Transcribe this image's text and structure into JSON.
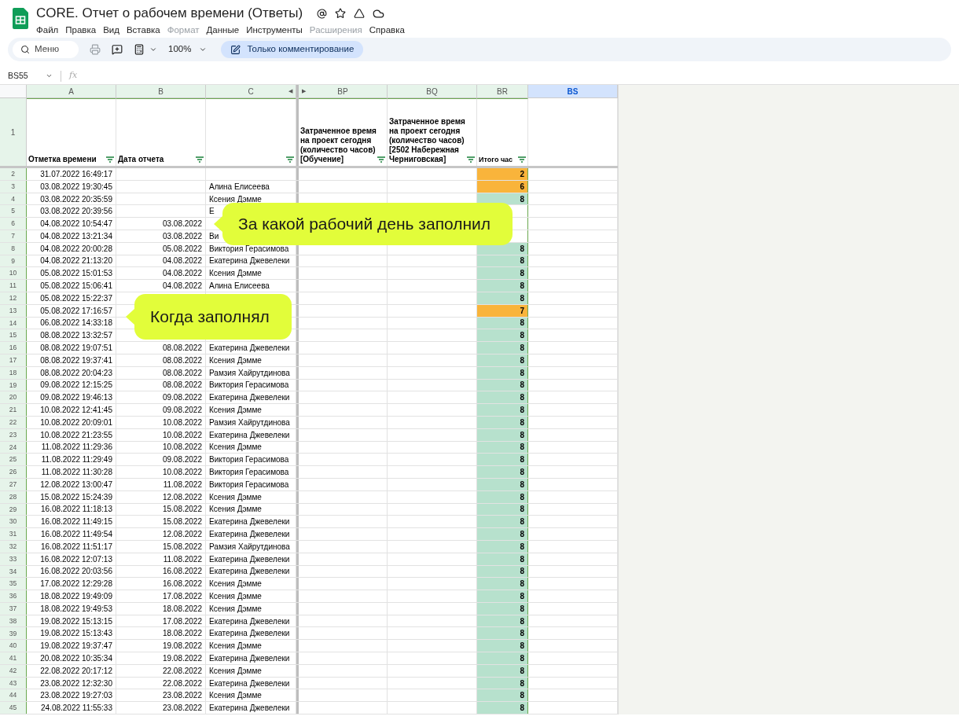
{
  "doc": {
    "title": "CORE. Отчет о рабочем времени (Ответы)"
  },
  "menu": [
    {
      "label": "Файл",
      "disabled": false
    },
    {
      "label": "Правка",
      "disabled": false
    },
    {
      "label": "Вид",
      "disabled": false
    },
    {
      "label": "Вставка",
      "disabled": false
    },
    {
      "label": "Формат",
      "disabled": true
    },
    {
      "label": "Данные",
      "disabled": false
    },
    {
      "label": "Инструменты",
      "disabled": false
    },
    {
      "label": "Расширения",
      "disabled": true
    },
    {
      "label": "Справка",
      "disabled": false
    }
  ],
  "toolbar": {
    "search_placeholder": "Меню",
    "zoom": "100%",
    "mode_button": "Только комментирование"
  },
  "formula_bar": {
    "name_box": "BS55",
    "fx": "fx"
  },
  "header_row": "1",
  "columns": [
    {
      "letter": "A",
      "selected": false,
      "header": "Отметка времени",
      "filter": true
    },
    {
      "letter": "B",
      "selected": false,
      "header": "Дата отчета",
      "filter": true
    },
    {
      "letter": "C",
      "selected": false,
      "filter": true,
      "arrow": "◀"
    },
    {
      "letter": "BP",
      "selected": false,
      "arrow": "▶",
      "header": "Затраченное время на проект сегодня (количество часов) [Обучение]",
      "filter": true
    },
    {
      "letter": "BQ",
      "selected": false,
      "header": "Затраченное время на проект сегодня (количество часов) [2502 Набережная Черниговская]",
      "filter": true
    },
    {
      "letter": "BR",
      "selected": false,
      "header": "Итого час",
      "filter": true
    },
    {
      "letter": "BS",
      "selected": true,
      "filter": false
    }
  ],
  "rows": [
    {
      "n": "2",
      "a": "31.07.2022 16:49:17",
      "br": "2",
      "color": "#f9b43b"
    },
    {
      "n": "3",
      "a": "03.08.2022 19:30:45",
      "c": "Алина Елисеева",
      "br": "6",
      "color": "#f9b43b"
    },
    {
      "n": "4",
      "a": "03.08.2022 20:35:59",
      "c": "Ксения Дэмме",
      "br": "8",
      "color": "#b7e1cd"
    },
    {
      "n": "5",
      "a": "03.08.2022 20:39:56",
      "c": "Е"
    },
    {
      "n": "6",
      "a": "04.08.2022 10:54:47",
      "b": "03.08.2022"
    },
    {
      "n": "7",
      "a": "04.08.2022 13:21:34",
      "b": "03.08.2022",
      "c": "Ви"
    },
    {
      "n": "8",
      "a": "04.08.2022 20:00:28",
      "b": "05.08.2022",
      "c": "Виктория Герасимова",
      "br": "8",
      "color": "#b7e1cd"
    },
    {
      "n": "9",
      "a": "04.08.2022 21:13:20",
      "b": "04.08.2022",
      "c": "Екатерина Джевелеки",
      "br": "8",
      "color": "#b7e1cd"
    },
    {
      "n": "10",
      "a": "05.08.2022 15:01:53",
      "b": "04.08.2022",
      "c": "Ксения Дэмме",
      "br": "8",
      "color": "#b7e1cd"
    },
    {
      "n": "11",
      "a": "05.08.2022 15:06:41",
      "b": "04.08.2022",
      "c": "Алина Елисеева",
      "br": "8",
      "color": "#b7e1cd"
    },
    {
      "n": "12",
      "a": "05.08.2022 15:22:37",
      "br": "8",
      "color": "#b7e1cd"
    },
    {
      "n": "13",
      "a": "05.08.2022 17:16:57",
      "br": "7",
      "color": "#f9b43b"
    },
    {
      "n": "14",
      "a": "06.08.2022 14:33:18",
      "br": "8",
      "color": "#b7e1cd"
    },
    {
      "n": "15",
      "a": "08.08.2022 13:32:57",
      "br": "8",
      "color": "#b7e1cd"
    },
    {
      "n": "16",
      "a": "08.08.2022 19:07:51",
      "b": "08.08.2022",
      "c": "Екатерина Джевелеки",
      "br": "8",
      "color": "#b7e1cd"
    },
    {
      "n": "17",
      "a": "08.08.2022 19:37:41",
      "b": "08.08.2022",
      "c": "Ксения Дэмме",
      "br": "8",
      "color": "#b7e1cd"
    },
    {
      "n": "18",
      "a": "08.08.2022 20:04:23",
      "b": "08.08.2022",
      "c": "Рамзия Хайрутдинова",
      "br": "8",
      "color": "#b7e1cd"
    },
    {
      "n": "19",
      "a": "09.08.2022 12:15:25",
      "b": "08.08.2022",
      "c": "Виктория Герасимова",
      "br": "8",
      "color": "#b7e1cd"
    },
    {
      "n": "20",
      "a": "09.08.2022 19:46:13",
      "b": "09.08.2022",
      "c": "Екатерина Джевелеки",
      "br": "8",
      "color": "#b7e1cd"
    },
    {
      "n": "21",
      "a": "10.08.2022 12:41:45",
      "b": "09.08.2022",
      "c": "Ксения Дэмме",
      "br": "8",
      "color": "#b7e1cd"
    },
    {
      "n": "22",
      "a": "10.08.2022 20:09:01",
      "b": "10.08.2022",
      "c": "Рамзия Хайрутдинова",
      "br": "8",
      "color": "#b7e1cd"
    },
    {
      "n": "23",
      "a": "10.08.2022 21:23:55",
      "b": "10.08.2022",
      "c": "Екатерина Джевелеки",
      "br": "8",
      "color": "#b7e1cd"
    },
    {
      "n": "24",
      "a": "11.08.2022 11:29:36",
      "b": "10.08.2022",
      "c": "Ксения Дэмме",
      "br": "8",
      "color": "#b7e1cd"
    },
    {
      "n": "25",
      "a": "11.08.2022 11:29:49",
      "b": "09.08.2022",
      "c": "Виктория Герасимова",
      "br": "8",
      "color": "#b7e1cd"
    },
    {
      "n": "26",
      "a": "11.08.2022 11:30:28",
      "b": "10.08.2022",
      "c": "Виктория Герасимова",
      "br": "8",
      "color": "#b7e1cd"
    },
    {
      "n": "27",
      "a": "12.08.2022 13:00:47",
      "b": "11.08.2022",
      "c": "Виктория Герасимова",
      "br": "8",
      "color": "#b7e1cd"
    },
    {
      "n": "28",
      "a": "15.08.2022 15:24:39",
      "b": "12.08.2022",
      "c": "Ксения Дэмме",
      "br": "8",
      "color": "#b7e1cd"
    },
    {
      "n": "29",
      "a": "16.08.2022 11:18:13",
      "b": "15.08.2022",
      "c": "Ксения Дэмме",
      "br": "8",
      "color": "#b7e1cd"
    },
    {
      "n": "30",
      "a": "16.08.2022 11:49:15",
      "b": "15.08.2022",
      "c": "Екатерина Джевелеки",
      "br": "8",
      "color": "#b7e1cd"
    },
    {
      "n": "31",
      "a": "16.08.2022 11:49:54",
      "b": "12.08.2022",
      "c": "Екатерина Джевелеки",
      "br": "8",
      "color": "#b7e1cd"
    },
    {
      "n": "32",
      "a": "16.08.2022 11:51:17",
      "b": "15.08.2022",
      "c": "Рамзия Хайрутдинова",
      "br": "8",
      "color": "#b7e1cd"
    },
    {
      "n": "33",
      "a": "16.08.2022 12:07:13",
      "b": "11.08.2022",
      "c": "Екатерина Джевелеки",
      "br": "8",
      "color": "#b7e1cd"
    },
    {
      "n": "34",
      "a": "16.08.2022 20:03:56",
      "b": "16.08.2022",
      "c": "Екатерина Джевелеки",
      "br": "8",
      "color": "#b7e1cd"
    },
    {
      "n": "35",
      "a": "17.08.2022 12:29:28",
      "b": "16.08.2022",
      "c": "Ксения Дэмме",
      "br": "8",
      "color": "#b7e1cd"
    },
    {
      "n": "36",
      "a": "18.08.2022 19:49:09",
      "b": "17.08.2022",
      "c": "Ксения Дэмме",
      "br": "8",
      "color": "#b7e1cd"
    },
    {
      "n": "37",
      "a": "18.08.2022 19:49:53",
      "b": "18.08.2022",
      "c": "Ксения Дэмме",
      "br": "8",
      "color": "#b7e1cd"
    },
    {
      "n": "38",
      "a": "19.08.2022 15:13:15",
      "b": "17.08.2022",
      "c": "Екатерина Джевелеки",
      "br": "8",
      "color": "#b7e1cd"
    },
    {
      "n": "39",
      "a": "19.08.2022 15:13:43",
      "b": "18.08.2022",
      "c": "Екатерина Джевелеки",
      "br": "8",
      "color": "#b7e1cd"
    },
    {
      "n": "40",
      "a": "19.08.2022 19:37:47",
      "b": "19.08.2022",
      "c": "Ксения Дэмме",
      "br": "8",
      "color": "#b7e1cd"
    },
    {
      "n": "41",
      "a": "20.08.2022 10:35:34",
      "b": "19.08.2022",
      "c": "Екатерина Джевелеки",
      "br": "8",
      "color": "#b7e1cd"
    },
    {
      "n": "42",
      "a": "22.08.2022 20:17:12",
      "b": "22.08.2022",
      "c": "Ксения Дэмме",
      "br": "8",
      "color": "#b7e1cd"
    },
    {
      "n": "43",
      "a": "23.08.2022 12:32:30",
      "b": "22.08.2022",
      "c": "Екатерина Джевелеки",
      "br": "8",
      "color": "#b7e1cd"
    },
    {
      "n": "44",
      "a": "23.08.2022 19:27:03",
      "b": "23.08.2022",
      "c": "Ксения Дэмме",
      "br": "8",
      "color": "#b7e1cd"
    },
    {
      "n": "45",
      "a": "24.08.2022 11:55:33",
      "b": "23.08.2022",
      "c": "Екатерина Джевелеки",
      "br": "8",
      "color": "#b7e1cd"
    }
  ],
  "callouts": [
    {
      "text": "За какой рабочий день заполнил"
    },
    {
      "text": "Когда заполнял"
    }
  ]
}
